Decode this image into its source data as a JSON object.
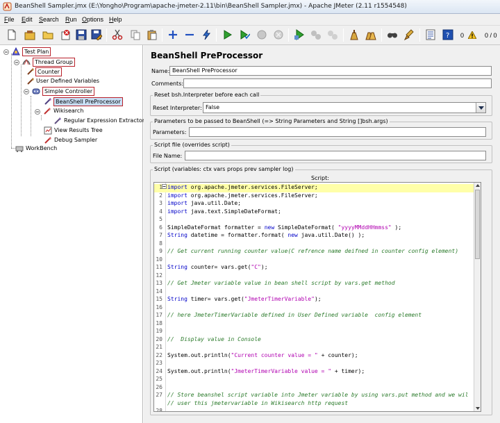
{
  "window": {
    "title": "BeanShell Sampler.jmx (E:\\Yongho\\Program\\apache-jmeter-2.11\\bin\\BeanShell Sampler.jmx) - Apache JMeter (2.11 r1554548)"
  },
  "menu": [
    "File",
    "Edit",
    "Search",
    "Run",
    "Options",
    "Help"
  ],
  "toolbar": {
    "buttons": [
      "new-icon",
      "templates-icon",
      "open-icon",
      "close-icon",
      "save-icon",
      "save-as-icon",
      "cut-icon",
      "copy-icon",
      "paste-icon",
      "expand-icon",
      "collapse-icon",
      "toggle-icon",
      "start-icon",
      "start-no-pause-icon",
      "stop-icon",
      "shutdown-icon",
      "remote-start-icon",
      "remote-stop-icon",
      "remote-shutdown-icon",
      "clear-icon",
      "clear-all-icon",
      "search-icon",
      "reset-search-icon",
      "function-helper-icon",
      "help-icon"
    ],
    "warning_count": "0",
    "threads_ratio": "0 / 0"
  },
  "tree": {
    "nodes": [
      {
        "label": "Test Plan",
        "icon": "test-plan-icon"
      },
      {
        "label": "Thread Group",
        "icon": "thread-group-icon"
      },
      {
        "label": "Counter",
        "icon": "counter-icon"
      },
      {
        "label": "User Defined Variables",
        "icon": "variables-icon"
      },
      {
        "label": "Simple Controller",
        "icon": "controller-icon"
      },
      {
        "label": "BeanShell PreProcessor",
        "icon": "preprocessor-icon"
      },
      {
        "label": "Wikisearch",
        "icon": "sampler-icon"
      },
      {
        "label": "Regular Expression Extractor",
        "icon": "extractor-icon"
      },
      {
        "label": "View Results Tree",
        "icon": "listener-icon"
      },
      {
        "label": "Debug Sampler",
        "icon": "sampler-icon"
      },
      {
        "label": "WorkBench",
        "icon": "workbench-icon"
      }
    ]
  },
  "editor": {
    "title": "BeanShell PreProcessor",
    "name_label": "Name:",
    "name_value": "BeanShell PreProcessor",
    "comments_label": "Comments:",
    "comments_value": "",
    "reset_group_title": "Reset bsh.Interpreter before each call",
    "reset_label": "Reset Interpreter:",
    "reset_value": "False",
    "params_group_title": "Parameters to be passed to BeanShell (=> String Parameters and String []bsh.args)",
    "params_label": "Parameters:",
    "params_value": "",
    "file_group_title": "Script file (overrides script)",
    "file_label": "File Name:",
    "file_value": "",
    "script_group_title": "Script (variables: ctx vars props prev sampler log)",
    "script_label": "Script:"
  },
  "script_lines": [
    {
      "n": "1",
      "text": "import org.apache.jmeter.services.FileServer;"
    },
    {
      "n": "2",
      "text": "import org.apache.jmeter.services.FileServer;"
    },
    {
      "n": "3",
      "text": "import java.util.Date;"
    },
    {
      "n": "4",
      "text": "import java.text.SimpleDateFormat;"
    },
    {
      "n": "5",
      "text": ""
    },
    {
      "n": "6",
      "text": "SimpleDateFormat formatter = new SimpleDateFormat( \"yyyyMMddHHmmss\" );"
    },
    {
      "n": "7",
      "text": "String datetime = formatter.format( new java.util.Date() );"
    },
    {
      "n": "8",
      "text": ""
    },
    {
      "n": "9",
      "text": "// Get current running counter value(C refrence name deifned in counter config element)"
    },
    {
      "n": "10",
      "text": ""
    },
    {
      "n": "11",
      "text": "String counter= vars.get(\"C\");"
    },
    {
      "n": "12",
      "text": ""
    },
    {
      "n": "13",
      "text": "// Get Jmeter variable value in bean shell script by vars.get method"
    },
    {
      "n": "14",
      "text": ""
    },
    {
      "n": "15",
      "text": "String timer= vars.get(\"JmeterTimerVariable\");"
    },
    {
      "n": "16",
      "text": ""
    },
    {
      "n": "17",
      "text": "// here JmeterTimerVariable defined in User Defined variable  config element"
    },
    {
      "n": "18",
      "text": ""
    },
    {
      "n": "19",
      "text": ""
    },
    {
      "n": "20",
      "text": "//  Display value in Console"
    },
    {
      "n": "21",
      "text": ""
    },
    {
      "n": "22",
      "text": "System.out.println(\"Current counter value = \" + counter);"
    },
    {
      "n": "23",
      "text": ""
    },
    {
      "n": "24",
      "text": "System.out.println(\"JmeterTimerVariable value = \" + timer);"
    },
    {
      "n": "25",
      "text": ""
    },
    {
      "n": "26",
      "text": ""
    },
    {
      "n": "27",
      "text": "// Store beanshel script variable into Jmeter variable by using vars.put method and we wil"
    },
    {
      "n": "",
      "text": "// user this jmetervariable in Wikisearch http request"
    },
    {
      "n": "28",
      "text": ""
    }
  ],
  "colors": {
    "selection": "#c9dff5",
    "highlight_line": "#ffffa8",
    "keyword": "#0000c8",
    "string": "#b000b0",
    "comment": "#2a7a2a",
    "box_border": "#b8202a"
  }
}
